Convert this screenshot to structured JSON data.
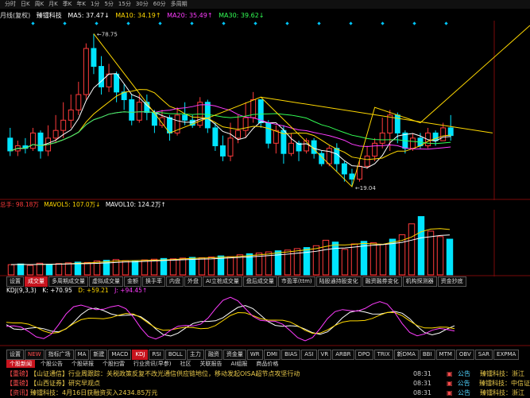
{
  "titlebar": {
    "items": [
      "分时",
      "日K",
      "周K",
      "月K",
      "季K",
      "年K",
      "1分",
      "5分",
      "15分",
      "30分",
      "60分",
      "多周期"
    ]
  },
  "main_header": {
    "period": "月线(复权)",
    "stock_name": "臻镭科技",
    "ma5": "MA5: 37.47↓",
    "ma10": "MA10: 34.19↑",
    "ma20": "MA20: 35.49↑",
    "ma30": "MA30: 39.62↓"
  },
  "annotations": {
    "high": "78.75",
    "low": "19.04"
  },
  "vol_header": {
    "label": "总手: 98.18万",
    "mavol5": "MAVOL5: 107.0万↓",
    "mavol10": "MAVOL10: 124.2万↑"
  },
  "toolbar1": [
    "设置",
    "成交量",
    "多周期成交量",
    "虚拟成交量",
    "金额",
    "换手率",
    "内盘",
    "外盘",
    "AI立桩成交量",
    "盘后成交量",
    "市盈率(ttm)",
    "陆股通持股变化",
    "融资融券变化",
    "机构探测器",
    "资金抄底"
  ],
  "kdj_header": {
    "name": "KDJ(9,3,3)",
    "k": "K: +70.95",
    "d": "D: +59.21",
    "j": "J: +94.45↑"
  },
  "toolbar2": [
    "设置",
    "NEW",
    "指标广场",
    "MA",
    "新建",
    "MACD",
    "KDJ",
    "RSI",
    "BOLL",
    "主力",
    "融资",
    "资金量",
    "WR",
    "DMI",
    "BIAS",
    "ASI",
    "VR",
    "ARBR",
    "DPO",
    "TRIX",
    "新DMA",
    "BBI",
    "MTM",
    "OBV",
    "SAR",
    "EXPMA"
  ],
  "news_tabs": [
    "个股新闻",
    "个股公告",
    "个股研报",
    "个股扫雷",
    "行业资讯(早参)",
    "社区",
    "关联报告",
    "AI组报",
    "商品价格"
  ],
  "news": [
    {
      "tag": "【重磅】",
      "text": "【山证通信】行业周跟踪：关税政策反复不改光通信供应链地位，移动发起OISA超节点攻坚行动",
      "time": "08:31"
    },
    {
      "tag": "【重磅】",
      "text": "【山西证券】研究早观点",
      "time": "08:31"
    },
    {
      "tag": "【资讯】",
      "text": "臻镭科技：4月16日获融资买入2434.85万元",
      "time": "08:31"
    }
  ],
  "right_panel": [
    {
      "tag": "公告",
      "text": "臻镭科技：浙江"
    },
    {
      "tag": "公告",
      "text": "臻镭科技：中信证"
    },
    {
      "tag": "公告",
      "text": "臻镭科技：浙江"
    }
  ],
  "colors": {
    "up": "#ff3b3b",
    "down": "#00e5ff",
    "ma5": "#ffffff",
    "ma10": "#ffd800",
    "ma20": "#ff3cff",
    "ma30": "#33ff55"
  },
  "chart_data": {
    "type": "candlestick",
    "note_prices": {
      "high": 78.75,
      "low": 19.04
    },
    "candles": [
      {
        "o": 38,
        "c": 33,
        "h": 42,
        "l": 31
      },
      {
        "o": 33,
        "c": 35,
        "h": 37,
        "l": 31
      },
      {
        "o": 35,
        "c": 34,
        "h": 38,
        "l": 32
      },
      {
        "o": 34,
        "c": 40,
        "h": 42,
        "l": 33
      },
      {
        "o": 40,
        "c": 33,
        "h": 41,
        "l": 30
      },
      {
        "o": 33,
        "c": 38,
        "h": 43,
        "l": 31
      },
      {
        "o": 38,
        "c": 41,
        "h": 47,
        "l": 36
      },
      {
        "o": 41,
        "c": 45,
        "h": 52,
        "l": 38
      },
      {
        "o": 45,
        "c": 49,
        "h": 55,
        "l": 42
      },
      {
        "o": 49,
        "c": 55,
        "h": 60,
        "l": 47
      },
      {
        "o": 55,
        "c": 73,
        "h": 75,
        "l": 53
      },
      {
        "o": 73,
        "c": 66,
        "h": 78.75,
        "l": 63
      },
      {
        "o": 66,
        "c": 58,
        "h": 70,
        "l": 55
      },
      {
        "o": 58,
        "c": 63,
        "h": 67,
        "l": 56
      },
      {
        "o": 63,
        "c": 56,
        "h": 64,
        "l": 52
      },
      {
        "o": 56,
        "c": 53,
        "h": 59,
        "l": 49
      },
      {
        "o": 53,
        "c": 45,
        "h": 55,
        "l": 43
      },
      {
        "o": 45,
        "c": 52,
        "h": 55,
        "l": 44
      },
      {
        "o": 52,
        "c": 48,
        "h": 55,
        "l": 45
      },
      {
        "o": 48,
        "c": 43,
        "h": 49,
        "l": 40
      },
      {
        "o": 43,
        "c": 46,
        "h": 49,
        "l": 42
      },
      {
        "o": 46,
        "c": 40,
        "h": 47,
        "l": 37
      },
      {
        "o": 40,
        "c": 47,
        "h": 50,
        "l": 39
      },
      {
        "o": 47,
        "c": 45,
        "h": 52,
        "l": 43
      },
      {
        "o": 45,
        "c": 43,
        "h": 47,
        "l": 42
      },
      {
        "o": 43,
        "c": 52,
        "h": 54,
        "l": 42
      },
      {
        "o": 52,
        "c": 42,
        "h": 53,
        "l": 40
      },
      {
        "o": 42,
        "c": 35,
        "h": 44,
        "l": 33
      },
      {
        "o": 35,
        "c": 31,
        "h": 39,
        "l": 29
      },
      {
        "o": 31,
        "c": 38,
        "h": 44,
        "l": 29
      },
      {
        "o": 38,
        "c": 41,
        "h": 47,
        "l": 36
      },
      {
        "o": 41,
        "c": 46,
        "h": 52,
        "l": 38
      },
      {
        "o": 46,
        "c": 53,
        "h": 56,
        "l": 44
      },
      {
        "o": 53,
        "c": 44,
        "h": 53,
        "l": 42
      },
      {
        "o": 44,
        "c": 36,
        "h": 45,
        "l": 34
      },
      {
        "o": 36,
        "c": 41,
        "h": 43,
        "l": 32
      },
      {
        "o": 41,
        "c": 32,
        "h": 43,
        "l": 28
      },
      {
        "o": 32,
        "c": 36,
        "h": 40,
        "l": 31
      },
      {
        "o": 36,
        "c": 33,
        "h": 37,
        "l": 29
      },
      {
        "o": 33,
        "c": 37,
        "h": 38,
        "l": 32
      },
      {
        "o": 37,
        "c": 32,
        "h": 38,
        "l": 30
      },
      {
        "o": 32,
        "c": 28,
        "h": 33,
        "l": 27
      },
      {
        "o": 28,
        "c": 34,
        "h": 35,
        "l": 27
      },
      {
        "o": 34,
        "c": 28,
        "h": 36,
        "l": 25
      },
      {
        "o": 28,
        "c": 24,
        "h": 29,
        "l": 21
      },
      {
        "o": 24,
        "c": 22,
        "h": 26,
        "l": 19.04
      },
      {
        "o": 22,
        "c": 27,
        "h": 29,
        "l": 21
      },
      {
        "o": 27,
        "c": 31,
        "h": 35,
        "l": 26
      },
      {
        "o": 31,
        "c": 36,
        "h": 38,
        "l": 29
      },
      {
        "o": 36,
        "c": 40,
        "h": 46,
        "l": 34
      },
      {
        "o": 40,
        "c": 47,
        "h": 49,
        "l": 33
      },
      {
        "o": 47,
        "c": 40,
        "h": 48,
        "l": 36
      },
      {
        "o": 40,
        "c": 34,
        "h": 41,
        "l": 32
      },
      {
        "o": 34,
        "c": 38,
        "h": 40,
        "l": 33
      },
      {
        "o": 38,
        "c": 35,
        "h": 40,
        "l": 34
      },
      {
        "o": 35,
        "c": 40,
        "h": 42,
        "l": 34
      },
      {
        "o": 40,
        "c": 37,
        "h": 41,
        "l": 35
      },
      {
        "o": 37,
        "c": 42,
        "h": 44,
        "l": 37
      },
      {
        "o": 42,
        "c": 39,
        "h": 47,
        "l": 37
      }
    ],
    "volume": [
      28,
      30,
      26,
      32,
      29,
      31,
      33,
      35,
      34,
      38,
      40,
      42,
      39,
      37,
      41,
      43,
      45,
      44,
      46,
      48,
      47,
      49,
      52,
      50,
      55,
      58,
      60,
      63,
      66,
      68,
      72,
      75,
      80,
      95,
      90,
      70,
      85,
      92,
      88,
      84,
      98,
      110,
      140,
      160,
      120,
      105,
      98
    ]
  }
}
